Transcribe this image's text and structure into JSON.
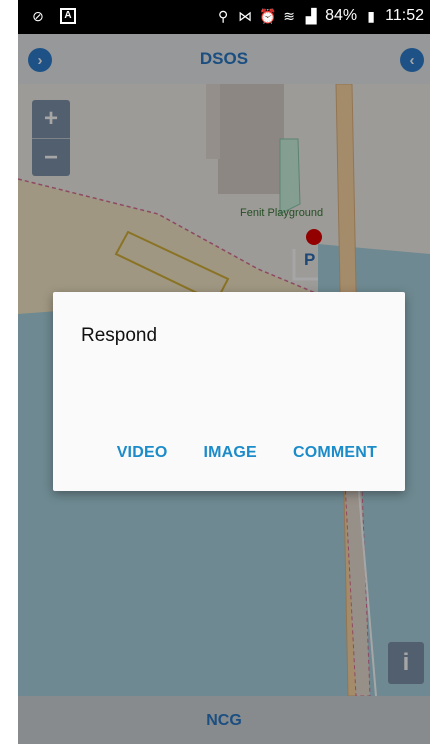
{
  "status_bar": {
    "battery": "84%",
    "time": "11:52",
    "left_icons": [
      "no-sim-icon",
      "text-input-icon"
    ],
    "right_icons": [
      "location-pin-icon",
      "vibrate-icon",
      "alarm-icon",
      "wifi-icon",
      "signal-icon",
      "battery-icon"
    ]
  },
  "header": {
    "title": "DSOS",
    "left_button_icon": "chevron-right-circle-icon",
    "right_button_icon": "chevron-left-circle-icon"
  },
  "map": {
    "zoom_in": "+",
    "zoom_out": "−",
    "poi_label": "Fenit Playground",
    "parking_label": "P",
    "info_label": "i"
  },
  "dialog": {
    "title": "Respond",
    "actions": [
      "VIDEO",
      "IMAGE",
      "COMMENT"
    ]
  },
  "bottom_bar": {
    "label": "NCG"
  },
  "colors": {
    "accent": "#2a79c7",
    "dialog_action": "#1c8bc9",
    "water": "#aad3df",
    "marker": "#e00000"
  }
}
